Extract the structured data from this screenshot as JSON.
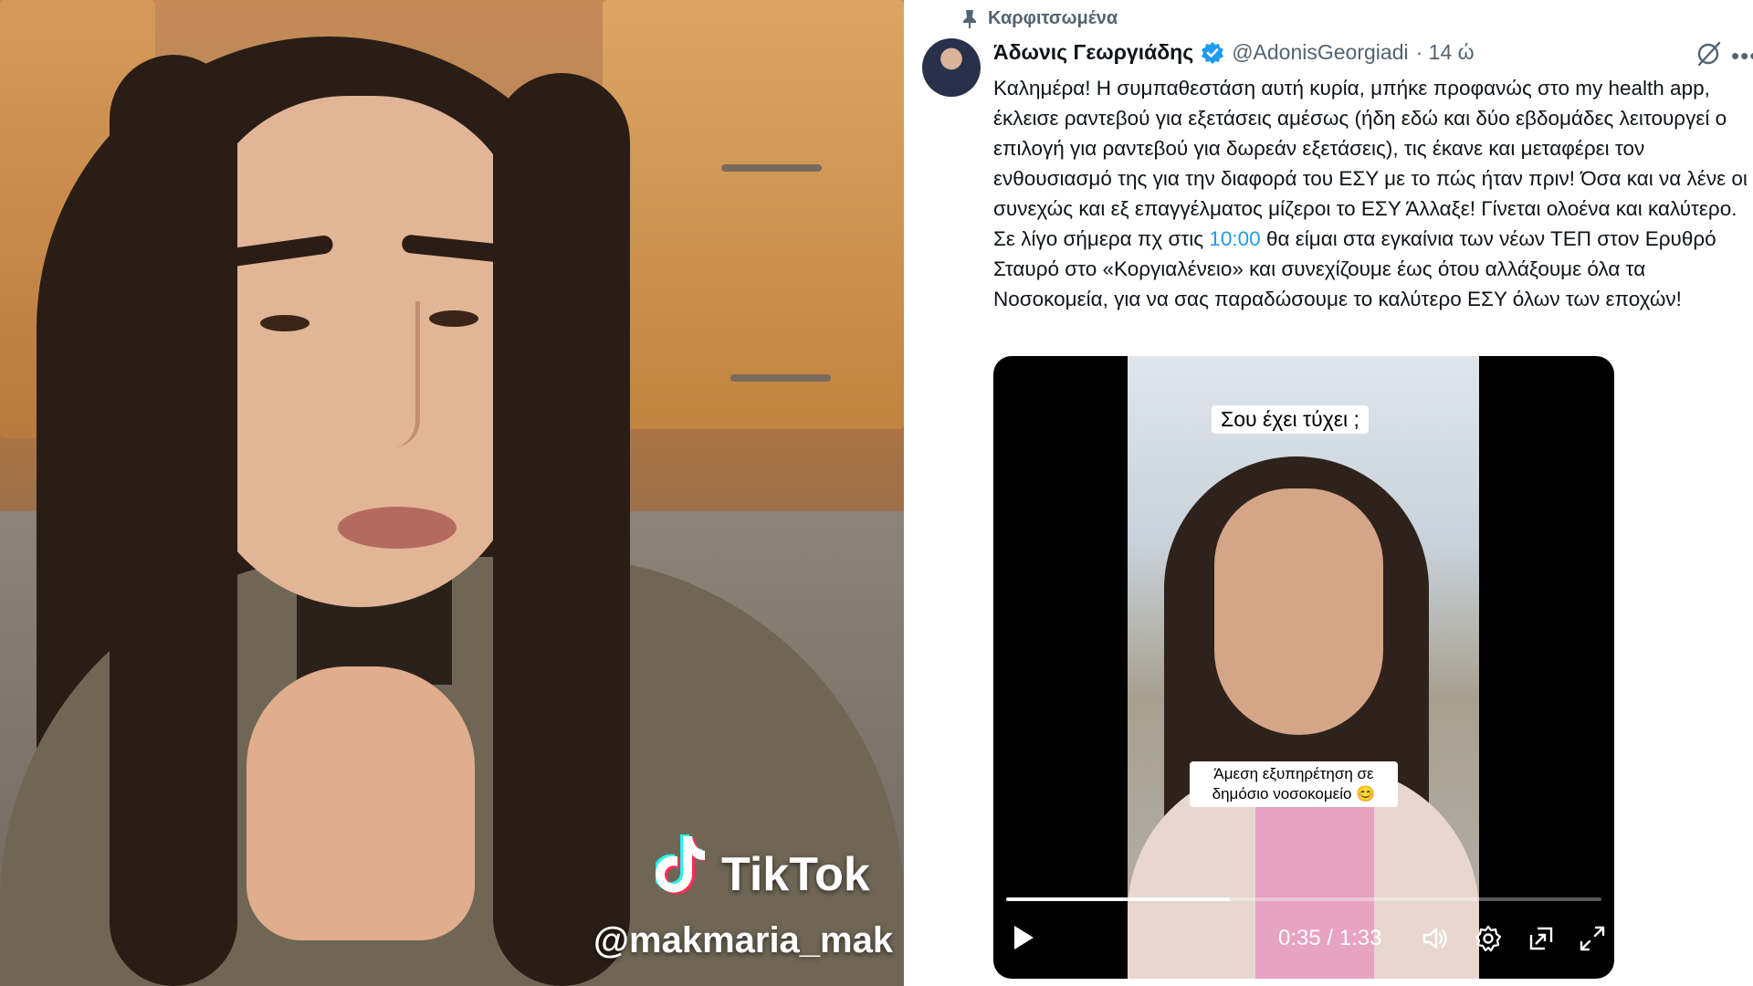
{
  "tiktok": {
    "wordmark": "TikTok",
    "handle": "@makmaria_mak"
  },
  "tweet": {
    "pinned_label": "Καρφιτσωμένα",
    "author_name": "Άδωνις Γεωργιάδης",
    "author_handle": "@AdonisGeorgiadi",
    "time": "· 14 ώ",
    "text_before_highlight": "Καλημέρα! Η συμπαθεστάση αυτή κυρία, μπήκε προφανώς στο my health app, έκλεισε ραντεβού για εξετάσεις αμέσως (ήδη εδώ και δύο εβδομάδες λειτουργεί ο επιλογή για ραντεβού για δωρεάν εξετάσεις), τις έκανε και μεταφέρει τον ενθουσιασμό της για την διαφορά του ΕΣΥ με το πώς ήταν πριν! Όσα και να λένε οι συνεχώς και εξ επαγγέλματος μίζεροι το ΕΣΥ Άλλαξε! Γίνεται ολοένα και καλύτερο. Σε λίγο σήμερα πχ στις ",
    "text_highlight": "10:00",
    "text_after_highlight": " θα είμαι στα εγκαίνια των νέων ΤΕΠ στον Ερυθρό Σταυρό στο «Κοργιαλένειο» και συνεχίζουμε έως ότου αλλάξουμε όλα τα Νοσοκομεία, για να σας παραδώσουμε το καλύτερο ΕΣΥ όλων των εποχών!",
    "highlight_color": "#1d9bf0"
  },
  "video": {
    "caption_top": "Σου έχει τύχει ;",
    "caption_bottom": "Άμεση εξυπηρέτηση σε δημόσιο νοσοκομείο 😊",
    "time_display": "0:35 / 1:33",
    "progress_fraction": 0.376,
    "icons": [
      "play-icon",
      "volume-icon",
      "settings-icon",
      "pip-icon",
      "fullscreen-icon"
    ]
  }
}
